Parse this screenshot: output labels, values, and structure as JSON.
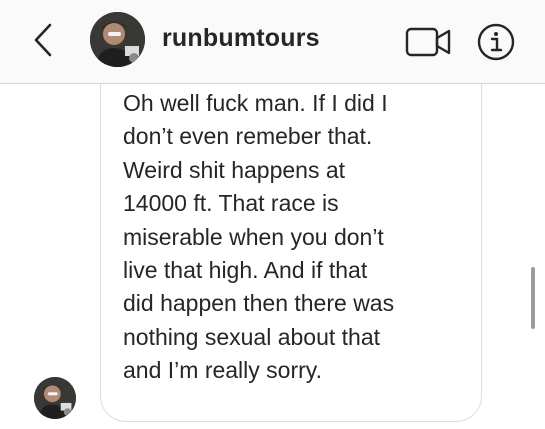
{
  "header": {
    "username": "runbumtours",
    "back_icon": "chevron-left-icon",
    "video_icon": "video-call-icon",
    "info_icon": "info-icon"
  },
  "conversation": {
    "messages": [
      {
        "sender": "runbumtours",
        "text": "Oh well fuck man. If I did I\ndon’t even remeber that.\nWeird shit happens at\n14000 ft. That race is\nmiserable when you don’t\nlive that high. And if that\ndid happen then there was\nnothing sexual about that\nand I’m really sorry."
      }
    ]
  },
  "colors": {
    "text": "#262626",
    "header_bg": "#fafafa",
    "border": "#dcdcdc"
  }
}
